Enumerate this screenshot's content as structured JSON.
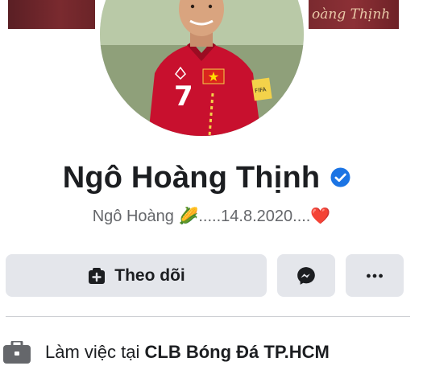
{
  "cover": {
    "signature_text": "oàng Thịnh"
  },
  "profile": {
    "name": "Ngô Hoàng Thịnh",
    "verified": true,
    "bio": {
      "prefix": "Ngô Hoàng ",
      "emoji_corn": "🌽",
      "middle": ".....14.8.2020....",
      "emoji_heart": "❤️"
    }
  },
  "actions": {
    "follow_label": "Theo dõi",
    "follow_icon": "add-friend-icon",
    "messenger_icon": "messenger-icon",
    "more_icon": "more-horizontal-icon"
  },
  "intro": {
    "work_prefix": "Làm việc tại ",
    "work_place": "CLB Bóng Đá TP.HCM",
    "icon": "briefcase-icon"
  },
  "colors": {
    "verified_blue": "#1b74e4",
    "button_gray": "#e4e6eb",
    "jersey_red": "#c8102e",
    "cover_maroon": "#7a2a2f"
  }
}
